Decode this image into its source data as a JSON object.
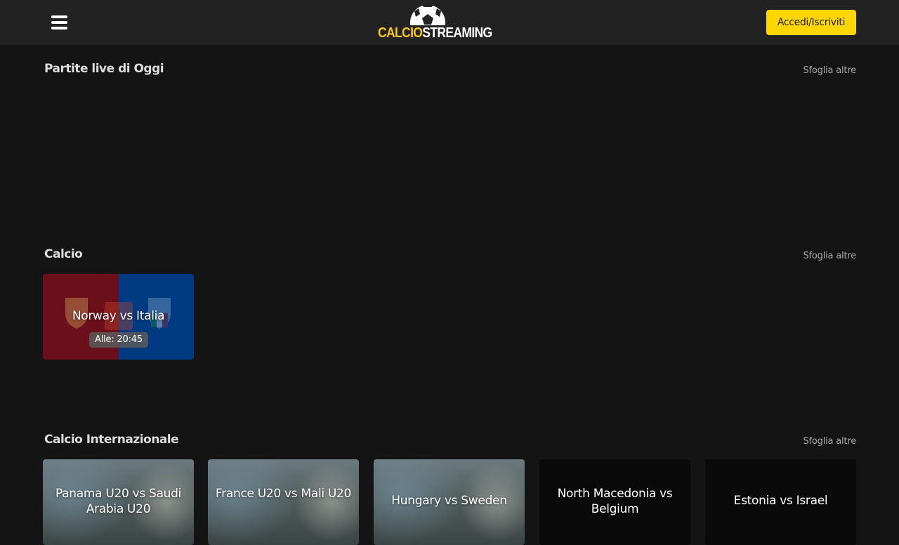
{
  "header": {
    "menu_icon": "hamburger-menu-icon",
    "logo": {
      "part1": "CALCIO",
      "part2": "STREAMING",
      "icon": "soccer-ball-icon"
    },
    "login_label": "Accedi/Iscriviti"
  },
  "sections": [
    {
      "title": "Partite live di Oggi",
      "browse_label": "Sfoglia altre"
    },
    {
      "title": "Calcio",
      "browse_label": "Sfoglia altre",
      "cards": [
        {
          "title": "Norway vs Italia",
          "time": "Alle: 20:45",
          "colors": [
            "#6b0f1a",
            "#003a80"
          ]
        }
      ]
    },
    {
      "title": "Calcio Internazionale",
      "browse_label": "Sfoglia altre",
      "cards": [
        {
          "title": "Panama U20 vs Saudi Arabia U20"
        },
        {
          "title": "France U20 vs Mali U20"
        },
        {
          "title": "Hungary vs Sweden"
        },
        {
          "title": "North Macedonia vs Belgium"
        },
        {
          "title": "Estonia vs Israel"
        }
      ]
    }
  ],
  "colors": {
    "accent": "#ffd600",
    "background": "#141414",
    "header": "#222222"
  }
}
